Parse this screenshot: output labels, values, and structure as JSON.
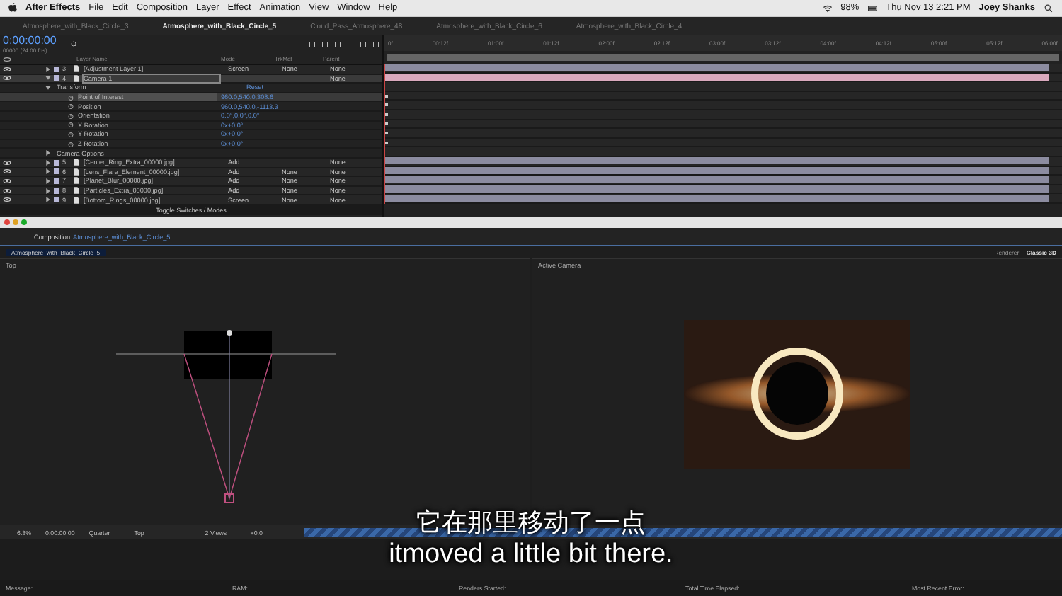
{
  "menubar": {
    "app": "After Effects",
    "items": [
      "File",
      "Edit",
      "Composition",
      "Layer",
      "Effect",
      "Animation",
      "View",
      "Window",
      "Help"
    ],
    "battery": "98%",
    "clock": "Thu Nov 13  2:21 PM",
    "user": "Joey Shanks"
  },
  "tabs": [
    {
      "label": "Atmosphere_with_Black_Circle_3",
      "selected": false
    },
    {
      "label": "Atmosphere_with_Black_Circle_5",
      "selected": true
    },
    {
      "label": "Cloud_Pass_Atmosphere_48",
      "selected": false
    },
    {
      "label": "Atmosphere_with_Black_Circle_6",
      "selected": false
    },
    {
      "label": "Atmosphere_with_Black_Circle_4",
      "selected": false
    }
  ],
  "timeline": {
    "timecode": "0:00:00:00",
    "frame_info": "00000 (24.00 fps)",
    "columns": [
      "Layer Name",
      "Mode",
      "T",
      "TrkMat",
      "Parent"
    ],
    "ruler": [
      "0f",
      "00:12f",
      "01:00f",
      "01:12f",
      "02:00f",
      "02:12f",
      "03:00f",
      "03:12f",
      "04:00f",
      "04:12f",
      "05:00f",
      "05:12f",
      "06:00f"
    ],
    "rows": [
      {
        "kind": "layer",
        "number": "3",
        "name": "[Adjustment Layer 1]",
        "mode": "Screen",
        "trkmat": "None",
        "parent": "None",
        "selected": false,
        "color": "#8c8ca0"
      },
      {
        "kind": "layer",
        "number": "4",
        "name": "Camera 1",
        "parent": "None",
        "selected": true,
        "color": "#d9a9bd"
      },
      {
        "kind": "group",
        "name": "Transform",
        "value": "Reset"
      },
      {
        "kind": "property",
        "name": "Point of Interest",
        "value": "960.0,540.0,308.6",
        "selected": true
      },
      {
        "kind": "property",
        "name": "Position",
        "value": "960.0,540.0,-1113.3",
        "selected": false
      },
      {
        "kind": "property",
        "name": "Orientation",
        "value": "0.0°,0.0°,0.0°",
        "selected": false
      },
      {
        "kind": "property",
        "name": "X Rotation",
        "value": "0x+0.0°",
        "selected": false
      },
      {
        "kind": "property",
        "name": "Y Rotation",
        "value": "0x+0.0°",
        "selected": false
      },
      {
        "kind": "property",
        "name": "Z Rotation",
        "value": "0x+0.0°",
        "selected": false
      },
      {
        "kind": "group",
        "name": "Camera Options"
      },
      {
        "kind": "layer",
        "number": "5",
        "name": "[Center_Ring_Extra_00000.jpg]",
        "mode": "Add",
        "parent": "None",
        "selected": false,
        "color": "#8c8ca0"
      },
      {
        "kind": "layer",
        "number": "6",
        "name": "[Lens_Flare_Element_00000.jpg]",
        "mode": "Add",
        "trkmat": "None",
        "parent": "None",
        "selected": false,
        "color": "#8c8ca0"
      },
      {
        "kind": "layer",
        "number": "7",
        "name": "[Planet_Blur_00000.jpg]",
        "mode": "Add",
        "trkmat": "None",
        "parent": "None",
        "selected": false,
        "color": "#8c8ca0"
      },
      {
        "kind": "layer",
        "number": "8",
        "name": "[Particles_Extra_00000.jpg]",
        "mode": "Add",
        "trkmat": "None",
        "parent": "None",
        "selected": false,
        "color": "#8c8ca0"
      },
      {
        "kind": "layer",
        "number": "9",
        "name": "[Bottom_Rings_00000.jpg]",
        "mode": "Screen",
        "trkmat": "None",
        "parent": "None",
        "selected": false,
        "color": "#8c8ca0"
      }
    ],
    "footer": "Toggle Switches / Modes"
  },
  "composition": {
    "panel_label": "Composition",
    "tab": "Atmosphere_with_Black_Circle_5",
    "subtab": "Atmosphere_with_Black_Circle_5",
    "renderer_label": "Renderer:",
    "renderer": "Classic 3D",
    "views": [
      {
        "label": "Top",
        "kind": "top"
      },
      {
        "label": "Active Camera",
        "kind": "camera"
      }
    ],
    "toolbar": {
      "zoom": "6.3%",
      "timecode": "0:00:00:00",
      "resolution": "Quarter",
      "view": "Top",
      "layout": "2 Views",
      "exposure": "+0.0"
    }
  },
  "subtitles": [
    "它在那里移动了一点",
    "itmoved a little bit there."
  ],
  "status_bar": [
    "Message:",
    "RAM:",
    "Renders Started:",
    "Total Time Elapsed:",
    "Most Recent Error:"
  ]
}
